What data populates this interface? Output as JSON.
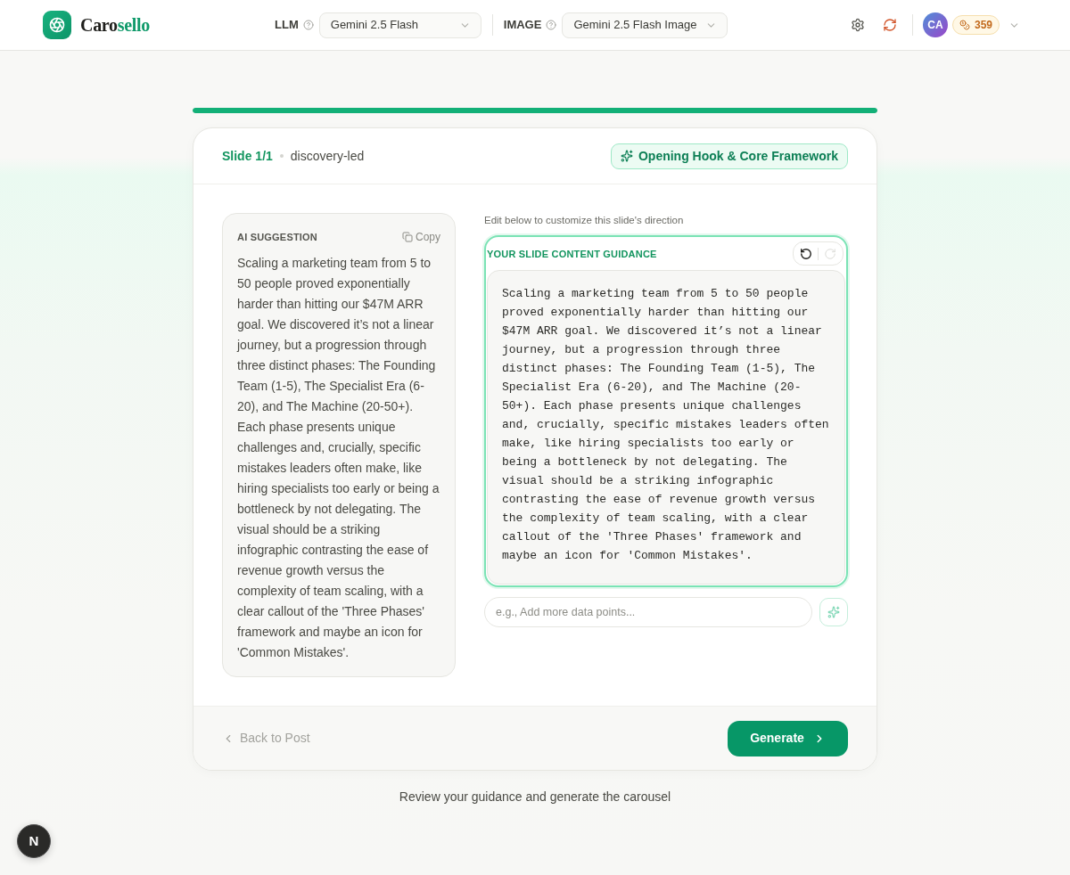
{
  "header": {
    "brand": {
      "text_dark": "Caro",
      "text_accent": "sello"
    },
    "model_selects": [
      {
        "label": "LLM",
        "value": "Gemini 2.5 Flash"
      },
      {
        "label": "IMAGE",
        "value": "Gemini 2.5 Flash Image"
      }
    ],
    "user": {
      "initials": "CA",
      "credits": "359"
    }
  },
  "progress": {
    "level": 1
  },
  "card": {
    "slide_label": "Slide 1/1",
    "slide_type": "discovery-led",
    "section_badge": "Opening Hook & Core Framework",
    "ai_suggestion": {
      "title": "AI SUGGESTION",
      "copy_label": "Copy",
      "text": "Scaling a marketing team from 5 to 50 people proved exponentially harder than hitting our $47M ARR goal. We discovered it’s not a linear journey, but a progression through three distinct phases: The Founding Team (1-5), The Specialist Era (6-20), and The Machine (20-50+). Each phase presents unique challenges and, crucially, specific mistakes leaders often make, like hiring specialists too early or being a bottleneck by not delegating. The visual should be a striking infographic contrasting the ease of revenue growth versus the complexity of team scaling, with a clear callout of the 'Three Phases' framework and maybe an icon for 'Common Mistakes'."
    },
    "guidance": {
      "hint": "Edit below to customize this slide's direction",
      "title": "YOUR SLIDE CONTENT GUIDANCE",
      "history_buttons": [
        {
          "kind": "undo",
          "disabled": false
        },
        {
          "kind": "redo",
          "disabled": true
        }
      ],
      "value": "Scaling a marketing team from 5 to 50 people proved exponentially harder than hitting our $47M ARR goal. We discovered it’s not a linear journey, but a progression through three distinct phases: The Founding Team (1-5), The Specialist Era (6-20), and The Machine (20-50+). Each phase presents unique challenges and, crucially, specific mistakes leaders often make, like hiring specialists too early or being a bottleneck by not delegating. The visual should be a striking infographic contrasting the ease of revenue growth versus the complexity of team scaling, with a clear callout of the 'Three Phases' framework and maybe an icon for 'Common Mistakes'.",
      "refine_placeholder": "e.g., Add more data points..."
    },
    "footer": {
      "back_label": "Back to Post",
      "generate_label": "Generate"
    }
  },
  "footnote": "Review your guidance and generate the carousel",
  "dev_badge": "N"
}
